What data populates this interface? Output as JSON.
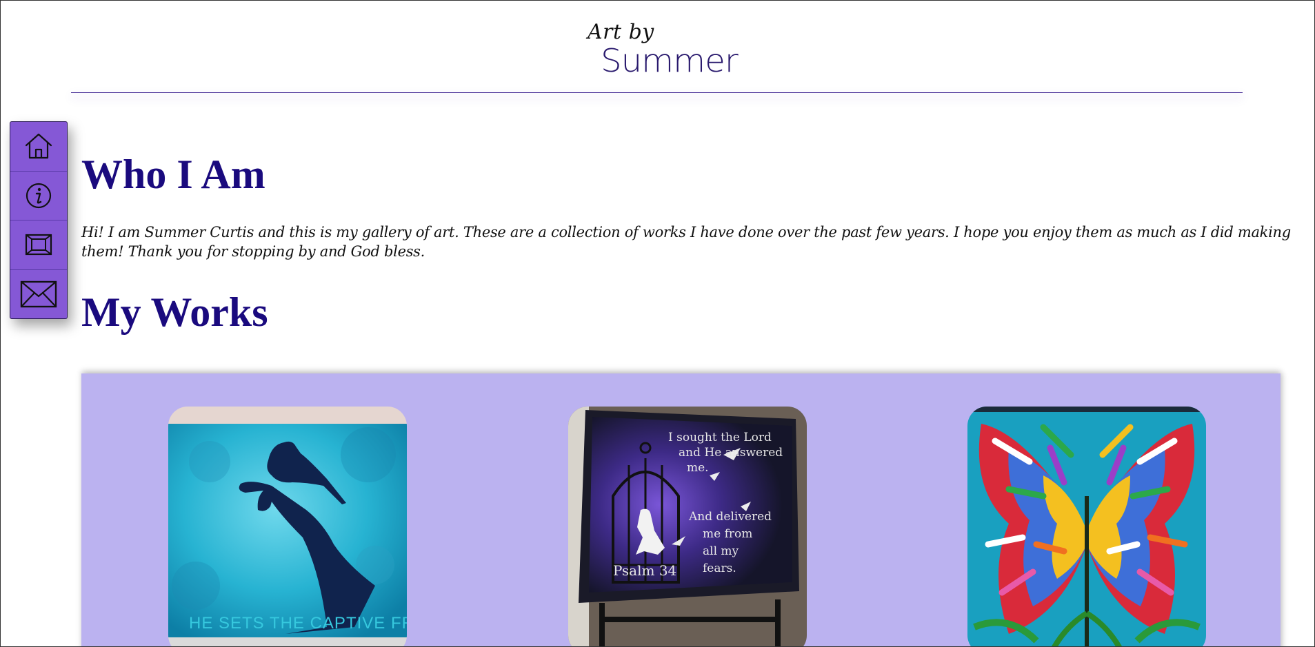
{
  "header": {
    "logo_line1": "Art by",
    "logo_line2": "Summer"
  },
  "sidenav": {
    "items": [
      {
        "icon": "home-icon"
      },
      {
        "icon": "info-icon"
      },
      {
        "icon": "gallery-icon"
      },
      {
        "icon": "mail-icon"
      }
    ]
  },
  "about": {
    "title": "Who I Am",
    "text": "Hi! I am Summer Curtis and this is my gallery of art. These are a collection of works I have done over the past few years. I hope you enjoy them as much as I did making them! Thank you for stopping by and God bless."
  },
  "works": {
    "title": "My Works",
    "artworks": [
      {
        "subject": "bird-on-hand painting",
        "caption_text": "HE SETS THE CAPTIVE FREE"
      },
      {
        "subject": "birdcage girl painting",
        "text_lines": [
          "I sought the Lord",
          "and He answered",
          "me.",
          "And delivered",
          "me from",
          "all my",
          "fears.",
          "Psalm 34"
        ]
      },
      {
        "subject": "abstract butterfly painting"
      }
    ]
  },
  "colors": {
    "accent_purple": "#8558d6",
    "title_navy": "#1a0a7e",
    "gallery_bg": "#bbb2f0"
  }
}
